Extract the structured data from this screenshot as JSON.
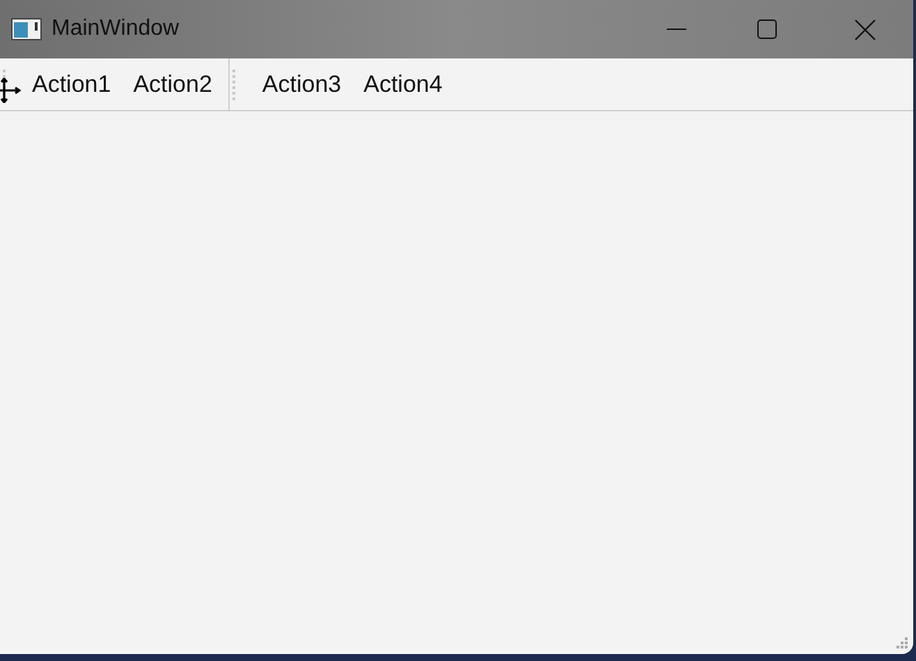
{
  "window": {
    "title": "MainWindow"
  },
  "toolbars": [
    {
      "actions": [
        "Action1",
        "Action2"
      ]
    },
    {
      "actions": [
        "Action3",
        "Action4"
      ]
    }
  ]
}
